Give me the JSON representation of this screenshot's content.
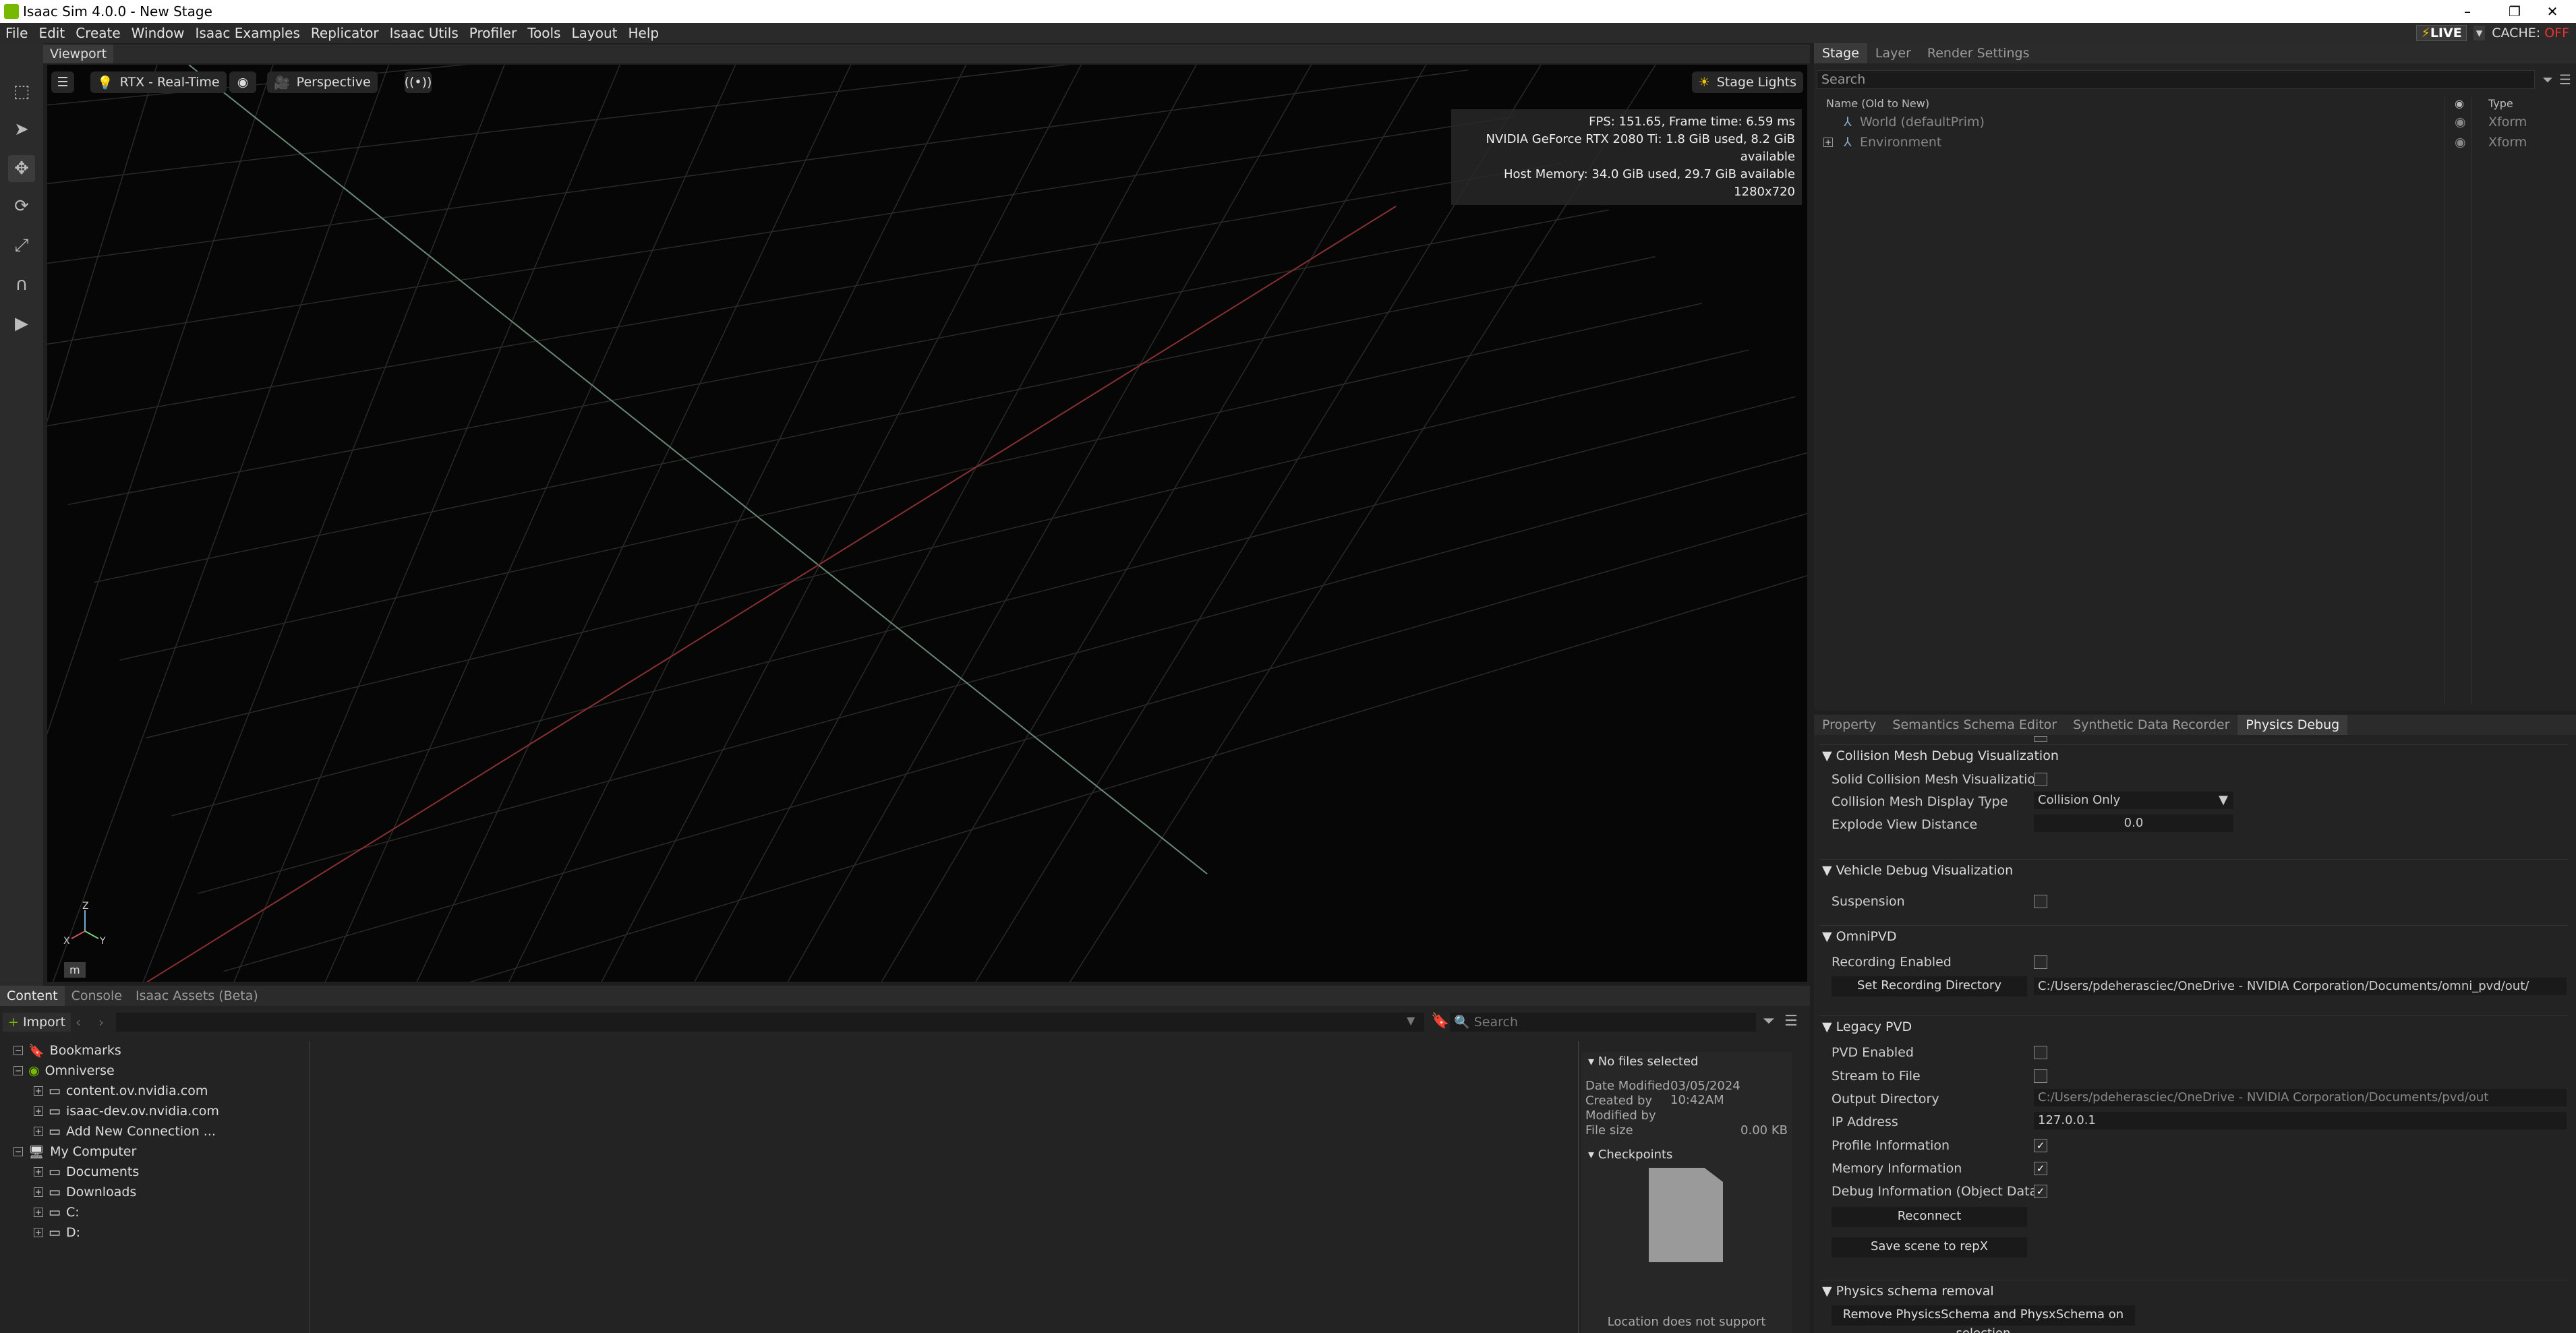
{
  "window": {
    "title": "Isaac Sim 4.0.0 - New Stage",
    "minimize": "–",
    "restore": "❐",
    "close": "✕"
  },
  "menu": {
    "items": [
      "File",
      "Edit",
      "Create",
      "Window",
      "Isaac Examples",
      "Replicator",
      "Isaac Utils",
      "Profiler",
      "Tools",
      "Layout",
      "Help"
    ],
    "live": "LIVE",
    "cache_label": "CACHE:",
    "cache_state": "OFF"
  },
  "viewport": {
    "tab": "Viewport",
    "render_mode": "RTX - Real-Time",
    "camera": "Perspective",
    "stage_lights": "Stage Lights",
    "stats": [
      "FPS: 151.65, Frame time: 6.59 ms",
      "NVIDIA GeForce RTX 2080 Ti: 1.8 GiB used, 8.2 GiB available",
      "Host Memory: 34.0 GiB used, 29.7 GiB available",
      "1280x720"
    ],
    "axis": {
      "z": "Z",
      "x": "X",
      "y": "Y"
    },
    "unit": "m",
    "colors": {
      "x_axis": "#8a3030",
      "y_axis": "#6a8a78",
      "grid": "#2a2a2a"
    }
  },
  "stage": {
    "tabs": [
      "Stage",
      "Layer",
      "Render Settings"
    ],
    "search_placeholder": "Search",
    "col_name": "Name (Old to New)",
    "col_type": "Type",
    "rows": [
      {
        "name": "World (defaultPrim)",
        "type": "Xform"
      },
      {
        "name": "Environment",
        "type": "Xform"
      }
    ]
  },
  "props": {
    "tabs": [
      "Property",
      "Semantics Schema Editor",
      "Synthetic Data Recorder",
      "Physics Debug"
    ],
    "collision": {
      "title": "Collision Mesh Debug Visualization",
      "solid_label": "Solid Collision Mesh Visualization",
      "display_type_label": "Collision Mesh Display Type",
      "display_type_value": "Collision Only",
      "explode_label": "Explode View Distance",
      "explode_value": "0.0"
    },
    "vehicle": {
      "title": "Vehicle Debug Visualization",
      "suspension_label": "Suspension"
    },
    "omnipvd": {
      "title": "OmniPVD",
      "recording_label": "Recording Enabled",
      "set_dir_button": "Set Recording Directory",
      "dir_value": "C:/Users/pdeherasciec/OneDrive - NVIDIA Corporation/Documents/omni_pvd/out/"
    },
    "legacy": {
      "title": "Legacy PVD",
      "pvd_enabled": "PVD Enabled",
      "stream_to_file": "Stream to File",
      "output_dir_label": "Output Directory",
      "output_dir_value": "C:/Users/pdeherasciec/OneDrive - NVIDIA Corporation/Documents/pvd/out",
      "ip_label": "IP Address",
      "ip_value": "127.0.0.1",
      "profile_info": "Profile Information",
      "memory_info": "Memory Information",
      "debug_info": "Debug Information (Object Data)",
      "reconnect": "Reconnect",
      "save_repx": "Save scene to repX"
    },
    "schema": {
      "title": "Physics schema removal",
      "remove_button": "Remove PhysicsSchema and PhysxSchema on selection"
    }
  },
  "content": {
    "tabs": [
      "Content",
      "Console",
      "Isaac Assets (Beta)"
    ],
    "import": "Import",
    "search_placeholder": "Search",
    "tree": {
      "bookmarks": "Bookmarks",
      "omniverse": "Omniverse",
      "servers": [
        "content.ov.nvidia.com",
        "isaac-dev.ov.nvidia.com",
        "Add New Connection ..."
      ],
      "my_computer": "My Computer",
      "drives": [
        "Documents",
        "Downloads",
        "C:",
        "D:"
      ]
    },
    "info": {
      "no_files": "No files selected",
      "date_modified_label": "Date Modified",
      "date_modified_value": "03/05/2024 10:42AM",
      "created_by": "Created by",
      "modified_by": "Modified by",
      "file_size_label": "File size",
      "file_size_value": "0.00 KB",
      "checkpoints": "Checkpoints",
      "location_msg": "Location does not support"
    }
  }
}
